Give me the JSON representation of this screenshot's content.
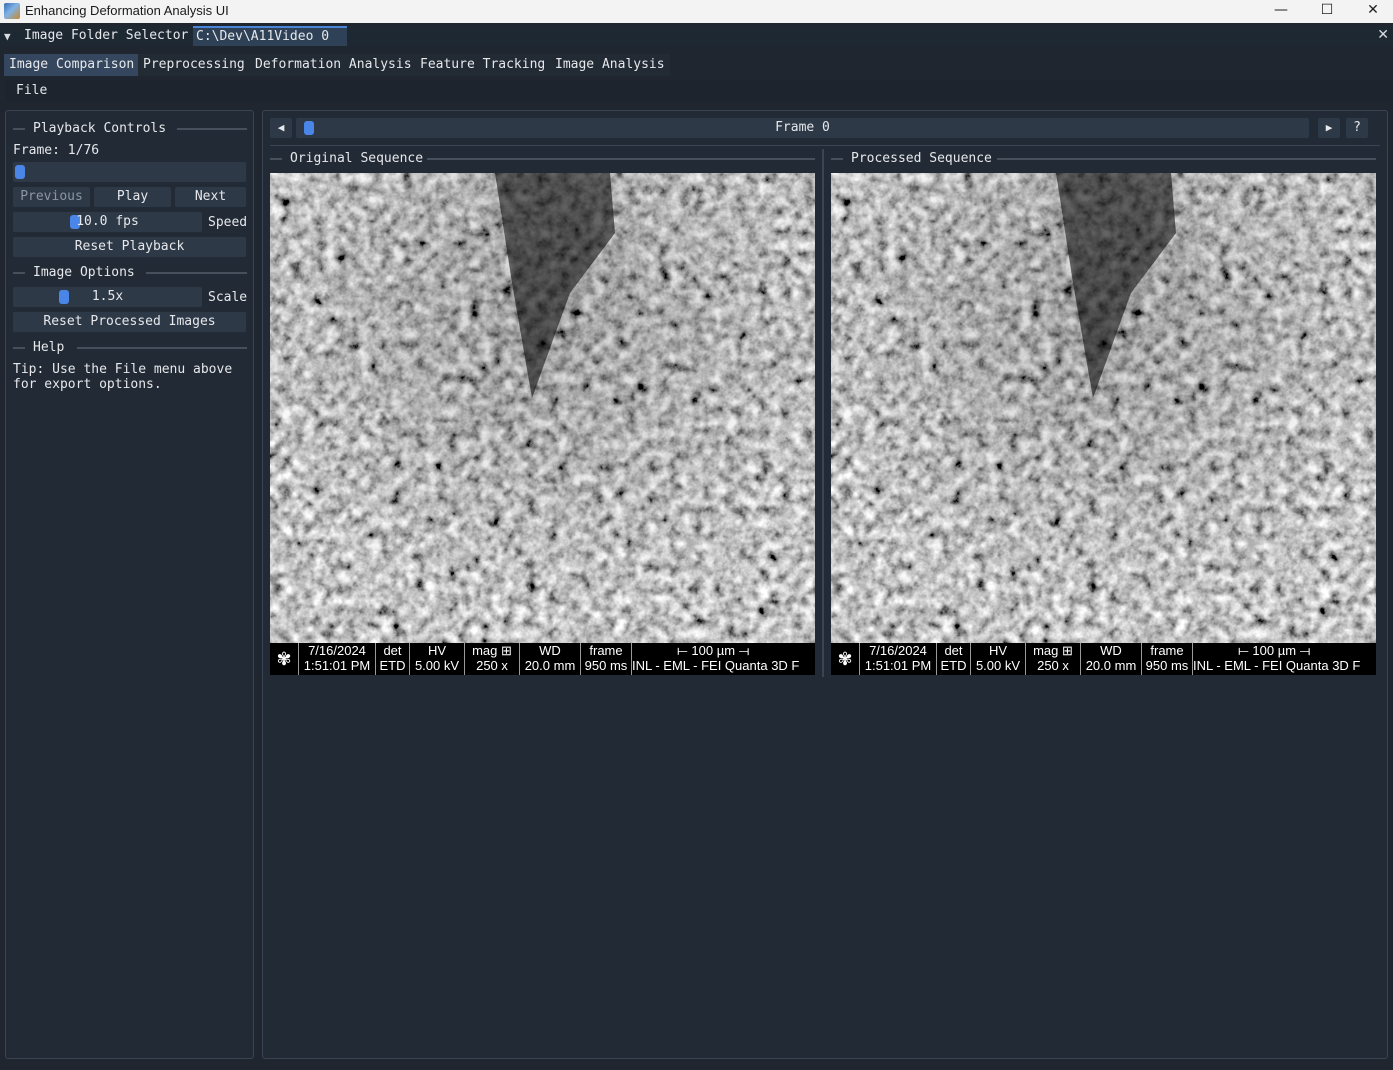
{
  "window": {
    "title": "Enhancing Deformation Analysis UI",
    "controls": {
      "minimize": "—",
      "maximize": "☐",
      "close": "✕"
    }
  },
  "folder_bar": {
    "label": "Image Folder Selector",
    "path": "C:\\Dev\\A11Video 0"
  },
  "tabs": [
    {
      "label": "Image Comparison",
      "active": true
    },
    {
      "label": "Preprocessing",
      "active": false
    },
    {
      "label": "Deformation Analysis",
      "active": false
    },
    {
      "label": "Feature Tracking",
      "active": false
    },
    {
      "label": "Image Analysis",
      "active": false
    }
  ],
  "menu": {
    "file": "File"
  },
  "sidebar": {
    "playback": {
      "header": "Playback Controls",
      "frame_text": "Frame: 1/76",
      "frame_progress": 0.0,
      "previous": "Previous",
      "play": "Play",
      "next": "Next",
      "speed_value": "10.0 fps",
      "speed_label": "Speed",
      "reset": "Reset Playback"
    },
    "image_options": {
      "header": "Image Options",
      "scale_value": "1.5x",
      "scale_label": "Scale",
      "reset": "Reset Processed Images"
    },
    "help": {
      "header": "Help",
      "line1": "Tip: Use the File menu above",
      "line2": "for export options."
    }
  },
  "frame_bar": {
    "prev_icon": "◀",
    "label": "Frame 0",
    "play_icon": "▶",
    "help": "?",
    "progress": 0.0
  },
  "views": {
    "original": {
      "header": "Original Sequence",
      "databar": {
        "date": "7/16/2024",
        "time": "1:51:01 PM",
        "det_label": "det",
        "det_value": "ETD",
        "hv_label": "HV",
        "hv_value": "5.00 kV",
        "mag_label": "mag ⊞",
        "mag_value": "250 x",
        "wd_label": "WD",
        "wd_value": "20.0 mm",
        "frame_label": "frame",
        "frame_value": "950 ms",
        "scale": "⟝ 100 µm ⟞",
        "instrument": "INL  -  EML  -  FEI Quanta 3D F"
      }
    },
    "processed": {
      "header": "Processed Sequence",
      "databar": {
        "date": "7/16/2024",
        "time": "1:51:01 PM",
        "det_label": "det",
        "det_value": "ETD",
        "hv_label": "HV",
        "hv_value": "5.00 kV",
        "mag_label": "mag ⊞",
        "mag_value": "250 x",
        "wd_label": "WD",
        "wd_value": "20.0 mm",
        "frame_label": "frame",
        "frame_value": "950 ms",
        "scale": "⟝ 100 µm ⟞",
        "instrument": "INL  -  EML  -  FEI Quanta 3D F"
      }
    }
  },
  "colors": {
    "background": "#1f2630",
    "panel": "#222a35",
    "accent": "#4a86e8",
    "button": "#2e3947"
  }
}
